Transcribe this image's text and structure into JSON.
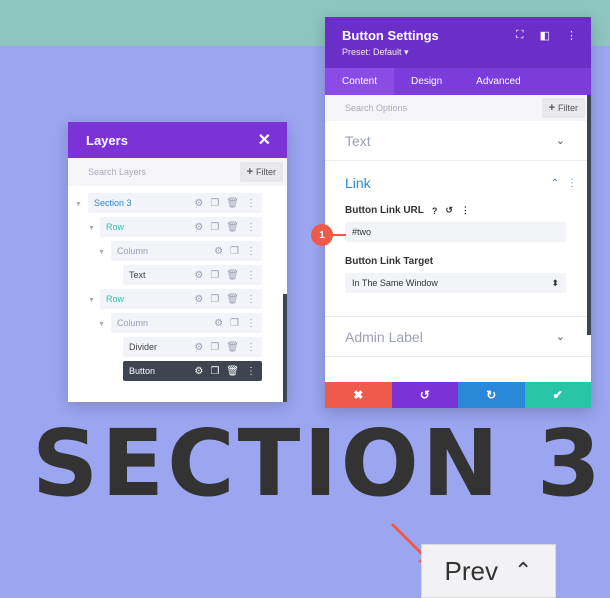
{
  "colors": {
    "background": "#9ba5f0",
    "top_strip": "#8ec5bf",
    "divi_purple": "#7b32d6",
    "link_blue": "#2b87da",
    "row_green": "#29c4a9",
    "cancel_red": "#ef5b4a",
    "undo_purple": "#7b32d6",
    "redo_blue": "#2b87da",
    "save_green": "#29c4a9"
  },
  "heading": {
    "text": "SECTION 3"
  },
  "prev_button": {
    "label": "Prev",
    "icon": "double-chevron-up-icon"
  },
  "layers": {
    "title": "Layers",
    "close_icon": "✕",
    "search_placeholder": "Search Layers",
    "filter_label": "Filter",
    "items": [
      {
        "label": "Section 3",
        "type": "section"
      },
      {
        "label": "Row",
        "type": "row"
      },
      {
        "label": "Column",
        "type": "column"
      },
      {
        "label": "Text",
        "type": "module"
      },
      {
        "label": "Row",
        "type": "row"
      },
      {
        "label": "Column",
        "type": "column"
      },
      {
        "label": "Divider",
        "type": "module"
      },
      {
        "label": "Button",
        "type": "module",
        "active": true
      }
    ]
  },
  "settings": {
    "title": "Button Settings",
    "preset": "Preset: Default ▾",
    "tabs": [
      "Content",
      "Design",
      "Advanced"
    ],
    "active_tab": "Content",
    "search_placeholder": "Search Options",
    "filter_label": "Filter",
    "groups": {
      "text": "Text",
      "link": "Link",
      "admin": "Admin Label"
    },
    "link_url_label": "Button Link URL",
    "link_url_value": "#two",
    "link_target_label": "Button Link Target",
    "link_target_value": "In The Same Window",
    "badge": "1"
  }
}
